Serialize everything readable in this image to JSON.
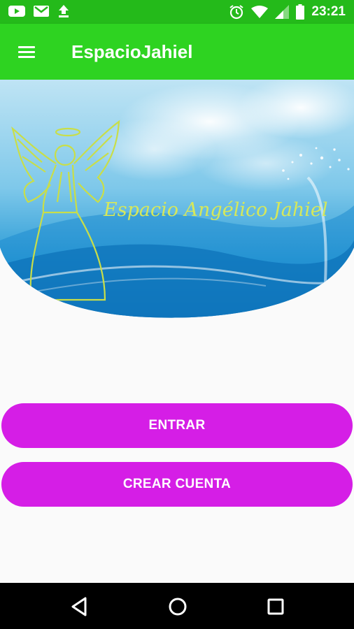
{
  "status_bar": {
    "time": "23:21",
    "icons_left": [
      "youtube-icon",
      "gmail-icon",
      "upload-icon"
    ],
    "icons_right": [
      "alarm-icon",
      "wifi-icon",
      "cell-signal-icon",
      "battery-icon"
    ]
  },
  "app_bar": {
    "title": "EspacioJahiel",
    "menu_icon": "hamburger-menu-icon",
    "background": "#2ed321"
  },
  "banner": {
    "logo_text": "Espacio Angélico Jahiel"
  },
  "buttons": {
    "enter_label": "ENTRAR",
    "create_account_label": "CREAR CUENTA",
    "color": "#d51ee6"
  },
  "nav_bar": {
    "icons": [
      "back-icon",
      "home-icon",
      "recents-icon"
    ]
  }
}
